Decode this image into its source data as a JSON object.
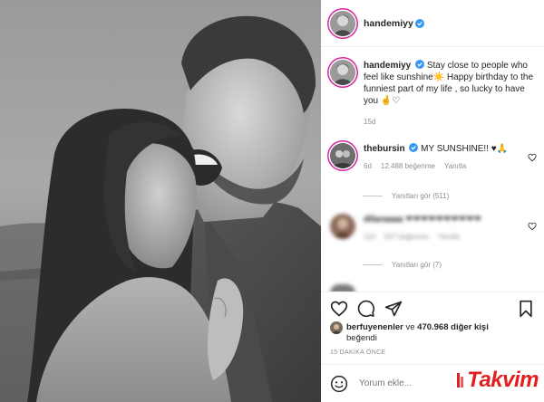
{
  "post": {
    "username": "handemiyy",
    "verified": true
  },
  "caption": {
    "username": "handemiyy",
    "text": "Stay close to people who feel like sunshine☀️ Happy birthday to the funniest part of my life , so lucky to have you 🤞♡",
    "age": "15d"
  },
  "comments": [
    {
      "username": "thebursin",
      "text": "MY SUNSHINE!! ♥🙏",
      "age": "6d",
      "likes": "12.488 beğenme",
      "reply": "Yanıtla",
      "view_replies": "Yanıtları gör (511)"
    },
    {
      "username": "dilaraaaa",
      "text": "❤❤❤❤❤❤❤❤❤❤",
      "age": "11d",
      "likes": "937 beğenme",
      "reply": "Yanıtla",
      "view_replies": "Yanıtları gör (7)"
    }
  ],
  "likes": {
    "first_user": "berfuyenenler",
    "connector": "ve",
    "others": "470.968 diğer kişi",
    "suffix": "beğendi"
  },
  "timestamp": "15 DAKİKA ÖNCE",
  "add_comment": {
    "placeholder": "Yorum ekle..."
  },
  "watermark": {
    "brand": "Takvim"
  },
  "icons": {
    "like": "heart-icon",
    "comment": "comment-icon",
    "share": "share-icon",
    "save": "bookmark-icon",
    "verified": "verified-badge-icon",
    "emoji": "emoji-icon"
  },
  "colors": {
    "verified": "#3897f0",
    "watermark": "#e02020",
    "story_ring": "#d6249f"
  }
}
